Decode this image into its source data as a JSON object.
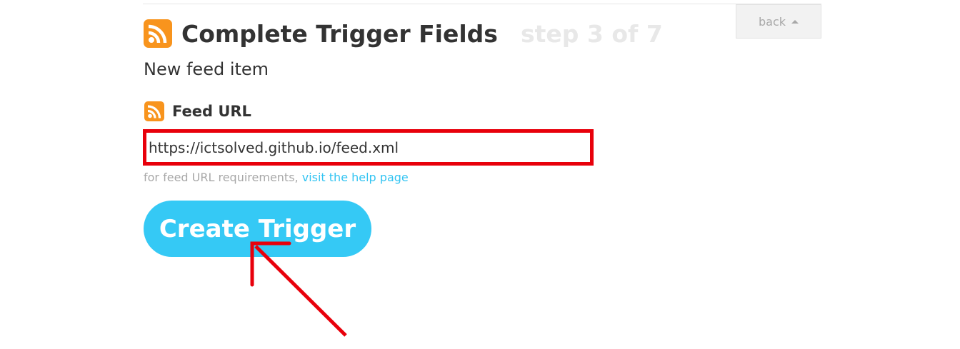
{
  "header": {
    "title": "Complete Trigger Fields",
    "step": "step 3 of 7",
    "back_label": "back"
  },
  "trigger": {
    "name": "New feed item"
  },
  "field": {
    "label": "Feed URL",
    "value": "https://ictsolved.github.io/feed.xml"
  },
  "help": {
    "text": "for feed URL requirements, ",
    "link_label": "visit the help page"
  },
  "actions": {
    "create_label": "Create Trigger"
  },
  "icons": {
    "service_icon": "rss-icon",
    "back_icon": "caret-up-icon"
  },
  "colors": {
    "rss_orange": "#f8941d",
    "button_blue": "#35c9f5",
    "link_blue": "#33c4f2",
    "annotation_red": "#e8000b"
  }
}
